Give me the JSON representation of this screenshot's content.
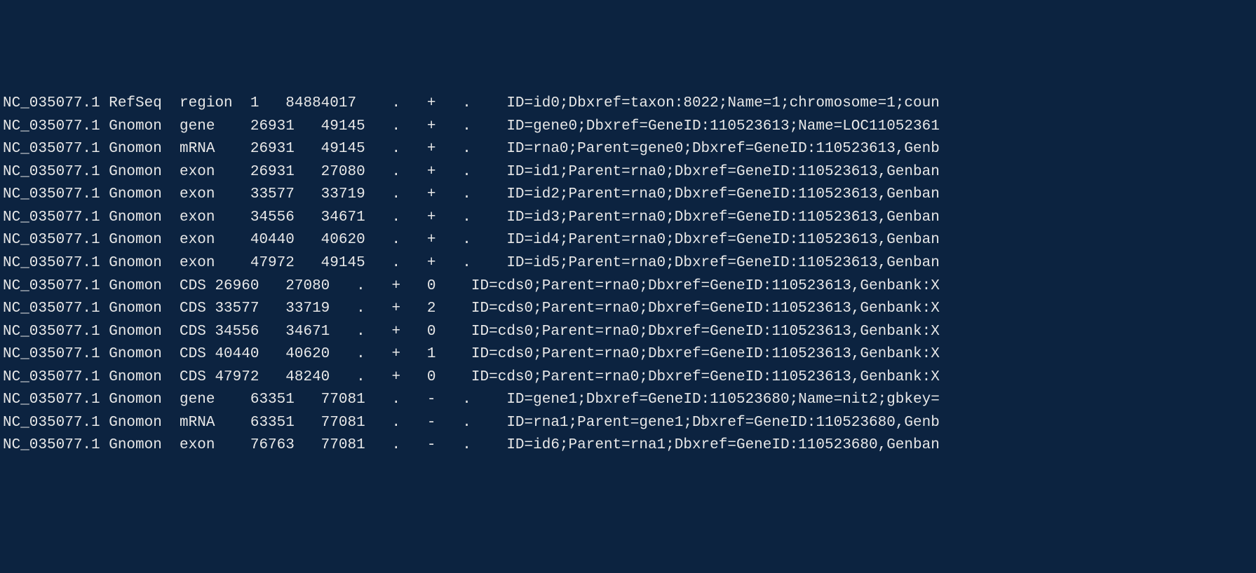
{
  "rows": [
    {
      "seqid": "NC_035077.1",
      "source": "RefSeq",
      "type": "region",
      "start": "1",
      "end": "84884017",
      "score": ".",
      "strand": "+",
      "phase": ".",
      "attributes": "ID=id0;Dbxref=taxon:8022;Name=1;chromosome=1;coun"
    },
    {
      "seqid": "NC_035077.1",
      "source": "Gnomon",
      "type": "gene",
      "start": "26931",
      "end": "49145",
      "score": ".",
      "strand": "+",
      "phase": ".",
      "attributes": "ID=gene0;Dbxref=GeneID:110523613;Name=LOC11052361"
    },
    {
      "seqid": "NC_035077.1",
      "source": "Gnomon",
      "type": "mRNA",
      "start": "26931",
      "end": "49145",
      "score": ".",
      "strand": "+",
      "phase": ".",
      "attributes": "ID=rna0;Parent=gene0;Dbxref=GeneID:110523613,Genb"
    },
    {
      "seqid": "NC_035077.1",
      "source": "Gnomon",
      "type": "exon",
      "start": "26931",
      "end": "27080",
      "score": ".",
      "strand": "+",
      "phase": ".",
      "attributes": "ID=id1;Parent=rna0;Dbxref=GeneID:110523613,Genban"
    },
    {
      "seqid": "NC_035077.1",
      "source": "Gnomon",
      "type": "exon",
      "start": "33577",
      "end": "33719",
      "score": ".",
      "strand": "+",
      "phase": ".",
      "attributes": "ID=id2;Parent=rna0;Dbxref=GeneID:110523613,Genban"
    },
    {
      "seqid": "NC_035077.1",
      "source": "Gnomon",
      "type": "exon",
      "start": "34556",
      "end": "34671",
      "score": ".",
      "strand": "+",
      "phase": ".",
      "attributes": "ID=id3;Parent=rna0;Dbxref=GeneID:110523613,Genban"
    },
    {
      "seqid": "NC_035077.1",
      "source": "Gnomon",
      "type": "exon",
      "start": "40440",
      "end": "40620",
      "score": ".",
      "strand": "+",
      "phase": ".",
      "attributes": "ID=id4;Parent=rna0;Dbxref=GeneID:110523613,Genban"
    },
    {
      "seqid": "NC_035077.1",
      "source": "Gnomon",
      "type": "exon",
      "start": "47972",
      "end": "49145",
      "score": ".",
      "strand": "+",
      "phase": ".",
      "attributes": "ID=id5;Parent=rna0;Dbxref=GeneID:110523613,Genban"
    },
    {
      "seqid": "NC_035077.1",
      "source": "Gnomon",
      "type": "CDS",
      "start": "26960",
      "end": "27080",
      "score": ".",
      "strand": "+",
      "phase": "0",
      "attributes": "ID=cds0;Parent=rna0;Dbxref=GeneID:110523613,Genbank:X"
    },
    {
      "seqid": "NC_035077.1",
      "source": "Gnomon",
      "type": "CDS",
      "start": "33577",
      "end": "33719",
      "score": ".",
      "strand": "+",
      "phase": "2",
      "attributes": "ID=cds0;Parent=rna0;Dbxref=GeneID:110523613,Genbank:X"
    },
    {
      "seqid": "NC_035077.1",
      "source": "Gnomon",
      "type": "CDS",
      "start": "34556",
      "end": "34671",
      "score": ".",
      "strand": "+",
      "phase": "0",
      "attributes": "ID=cds0;Parent=rna0;Dbxref=GeneID:110523613,Genbank:X"
    },
    {
      "seqid": "NC_035077.1",
      "source": "Gnomon",
      "type": "CDS",
      "start": "40440",
      "end": "40620",
      "score": ".",
      "strand": "+",
      "phase": "1",
      "attributes": "ID=cds0;Parent=rna0;Dbxref=GeneID:110523613,Genbank:X"
    },
    {
      "seqid": "NC_035077.1",
      "source": "Gnomon",
      "type": "CDS",
      "start": "47972",
      "end": "48240",
      "score": ".",
      "strand": "+",
      "phase": "0",
      "attributes": "ID=cds0;Parent=rna0;Dbxref=GeneID:110523613,Genbank:X"
    },
    {
      "seqid": "NC_035077.1",
      "source": "Gnomon",
      "type": "gene",
      "start": "63351",
      "end": "77081",
      "score": ".",
      "strand": "-",
      "phase": ".",
      "attributes": "ID=gene1;Dbxref=GeneID:110523680;Name=nit2;gbkey="
    },
    {
      "seqid": "NC_035077.1",
      "source": "Gnomon",
      "type": "mRNA",
      "start": "63351",
      "end": "77081",
      "score": ".",
      "strand": "-",
      "phase": ".",
      "attributes": "ID=rna1;Parent=gene1;Dbxref=GeneID:110523680,Genb"
    },
    {
      "seqid": "NC_035077.1",
      "source": "Gnomon",
      "type": "exon",
      "start": "76763",
      "end": "77081",
      "score": ".",
      "strand": "-",
      "phase": ".",
      "attributes": "ID=id6;Parent=rna1;Dbxref=GeneID:110523680,Genban"
    }
  ]
}
